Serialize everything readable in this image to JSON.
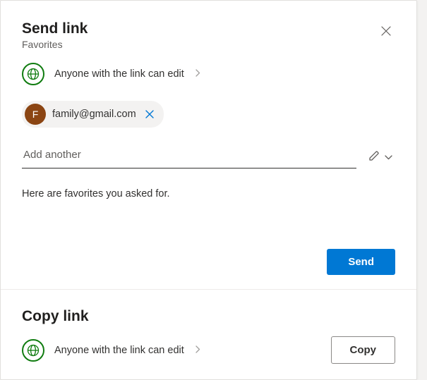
{
  "dialog": {
    "title": "Send link",
    "subtitle": "Favorites"
  },
  "scope": {
    "label": "Anyone with the link can edit"
  },
  "recipients": [
    {
      "initial": "F",
      "email": "family@gmail.com"
    }
  ],
  "input": {
    "placeholder": "Add another"
  },
  "message": {
    "text": "Here are favorites you asked for."
  },
  "buttons": {
    "send": "Send",
    "copy": "Copy"
  },
  "copySection": {
    "title": "Copy link",
    "scope": "Anyone with the link can edit"
  }
}
